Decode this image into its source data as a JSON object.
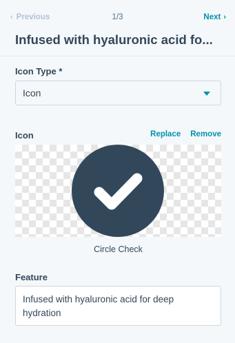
{
  "nav": {
    "previous": "Previous",
    "counter": "1/3",
    "next": "Next"
  },
  "title": "Infused with hyaluronic acid fo...",
  "icon_type": {
    "label": "Icon Type *",
    "value": "Icon"
  },
  "icon": {
    "label": "Icon",
    "replace": "Replace",
    "remove": "Remove",
    "name": "Circle Check"
  },
  "feature": {
    "label": "Feature",
    "value": "Infused with hyaluronic acid for deep hydration"
  },
  "colors": {
    "accent": "#0091ae",
    "icon_fill": "#33475b",
    "text": "#33475b",
    "panel_bg": "#f5f8fa"
  }
}
